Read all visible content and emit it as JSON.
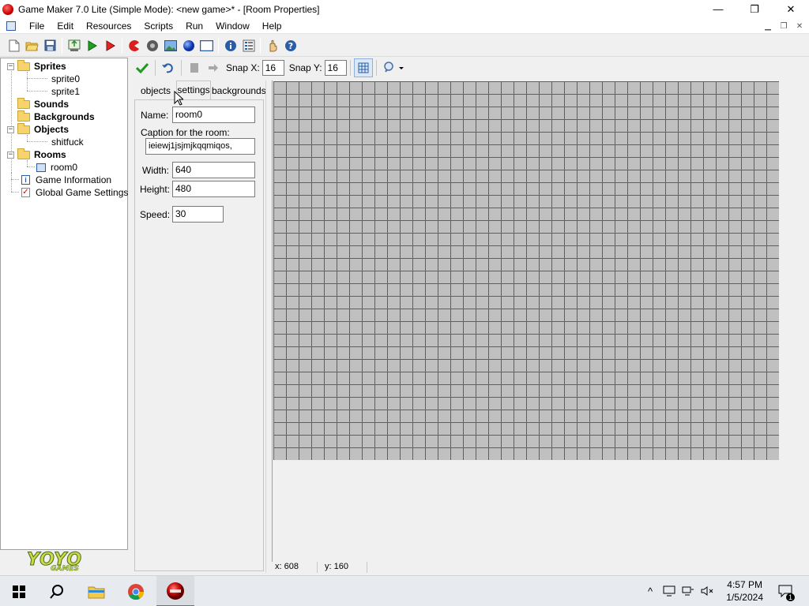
{
  "window": {
    "title": "Game Maker 7.0 Lite (Simple Mode): <new game>* - [Room Properties]",
    "minimize": "—",
    "maximize": "❐",
    "close": "✕"
  },
  "menu": {
    "items": [
      "File",
      "Edit",
      "Resources",
      "Scripts",
      "Run",
      "Window",
      "Help"
    ]
  },
  "tree": {
    "sprites": "Sprites",
    "sprite0": "sprite0",
    "sprite1": "sprite1",
    "sounds": "Sounds",
    "backgrounds": "Backgrounds",
    "objects": "Objects",
    "object0": "shitfuck",
    "rooms": "Rooms",
    "room0": "room0",
    "game_info": "Game Information",
    "global_settings": "Global Game Settings"
  },
  "room_toolbar": {
    "snap_x_label": "Snap X:",
    "snap_x": "16",
    "snap_y_label": "Snap Y:",
    "snap_y": "16"
  },
  "tabs": [
    "objects",
    "settings",
    "backgrounds"
  ],
  "settings": {
    "name_label": "Name:",
    "name": "room0",
    "caption_label": "Caption for the room:",
    "caption": "ieiewj1jsjmjkqqmiqos,",
    "width_label": "Width:",
    "width": "640",
    "height_label": "Height:",
    "height": "480",
    "speed_label": "Speed:",
    "speed": "30"
  },
  "status": {
    "x": "x: 608",
    "y": "y: 160"
  },
  "logo": {
    "top": "YOYO",
    "bottom": "GAMES"
  },
  "taskbar": {
    "time": "4:57 PM",
    "date": "1/5/2024",
    "notification_count": "1"
  },
  "colors": {
    "room_background": "#c0c0c0",
    "grid_lines": "#606060",
    "accent": "#3a7bd5"
  }
}
